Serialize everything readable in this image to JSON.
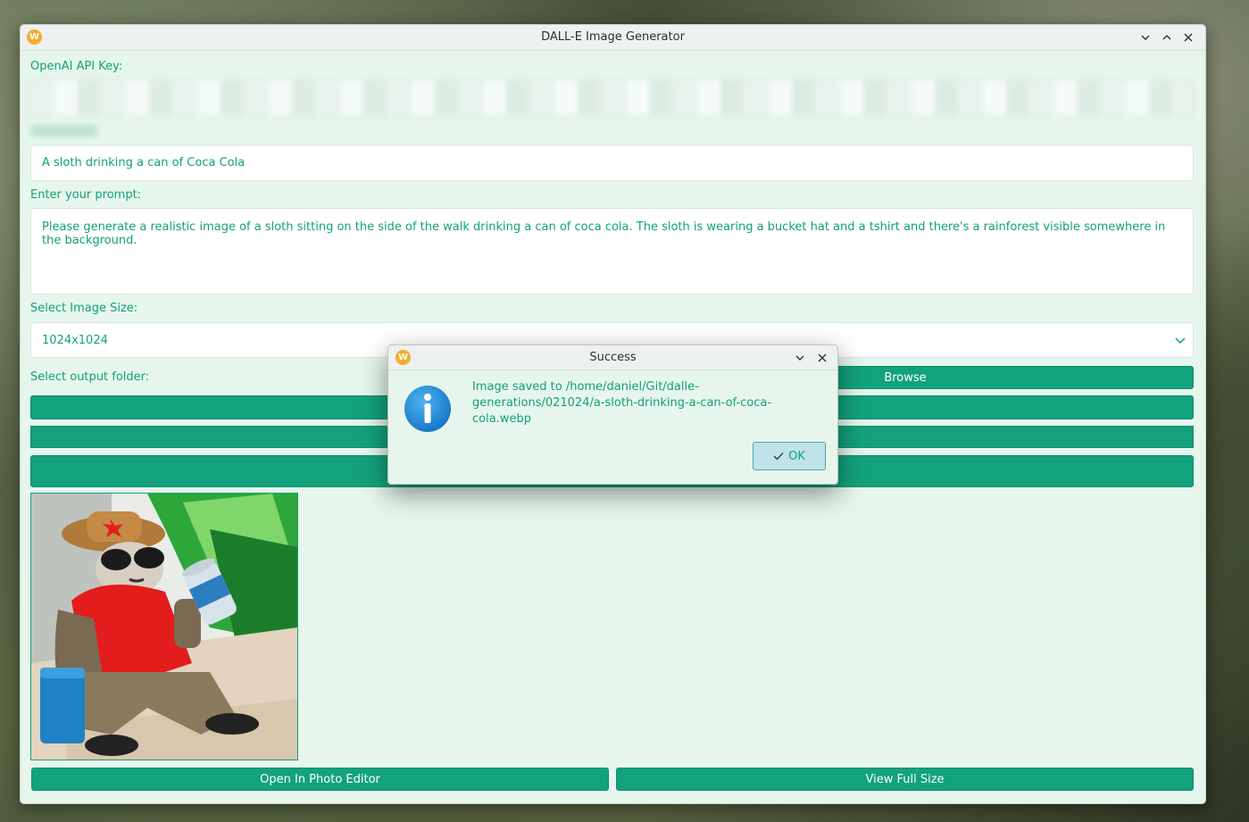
{
  "window": {
    "title": "DALL-E Image Generator",
    "app_icon_letter": "W"
  },
  "form": {
    "api_key_label": "OpenAI API Key:",
    "image_title_label_hidden": "",
    "image_title_value": "A sloth drinking a can of Coca Cola",
    "prompt_label": "Enter your prompt:",
    "prompt_value": "Please generate a realistic image of a sloth sitting on the side of the walk drinking a can of coca cola. The sloth is wearing a bucket hat and a tshirt and there's a rainforest visible somewhere in the background.",
    "size_label": "Select Image Size:",
    "size_value": "1024x1024",
    "output_folder_label": "Select output folder:",
    "browse_label": "Browse"
  },
  "bottom_buttons": {
    "open_editor": "Open In Photo Editor",
    "view_full_size": "View Full Size"
  },
  "dialog": {
    "title": "Success",
    "message": "Image saved to /home/daniel/Git/dalle-generations/021024/a-sloth-drinking-a-can-of-coca-cola.webp",
    "ok_label": "OK"
  },
  "colors": {
    "accent": "#12a27c",
    "window_bg": "#e6f6ec",
    "text": "#13a07a"
  }
}
